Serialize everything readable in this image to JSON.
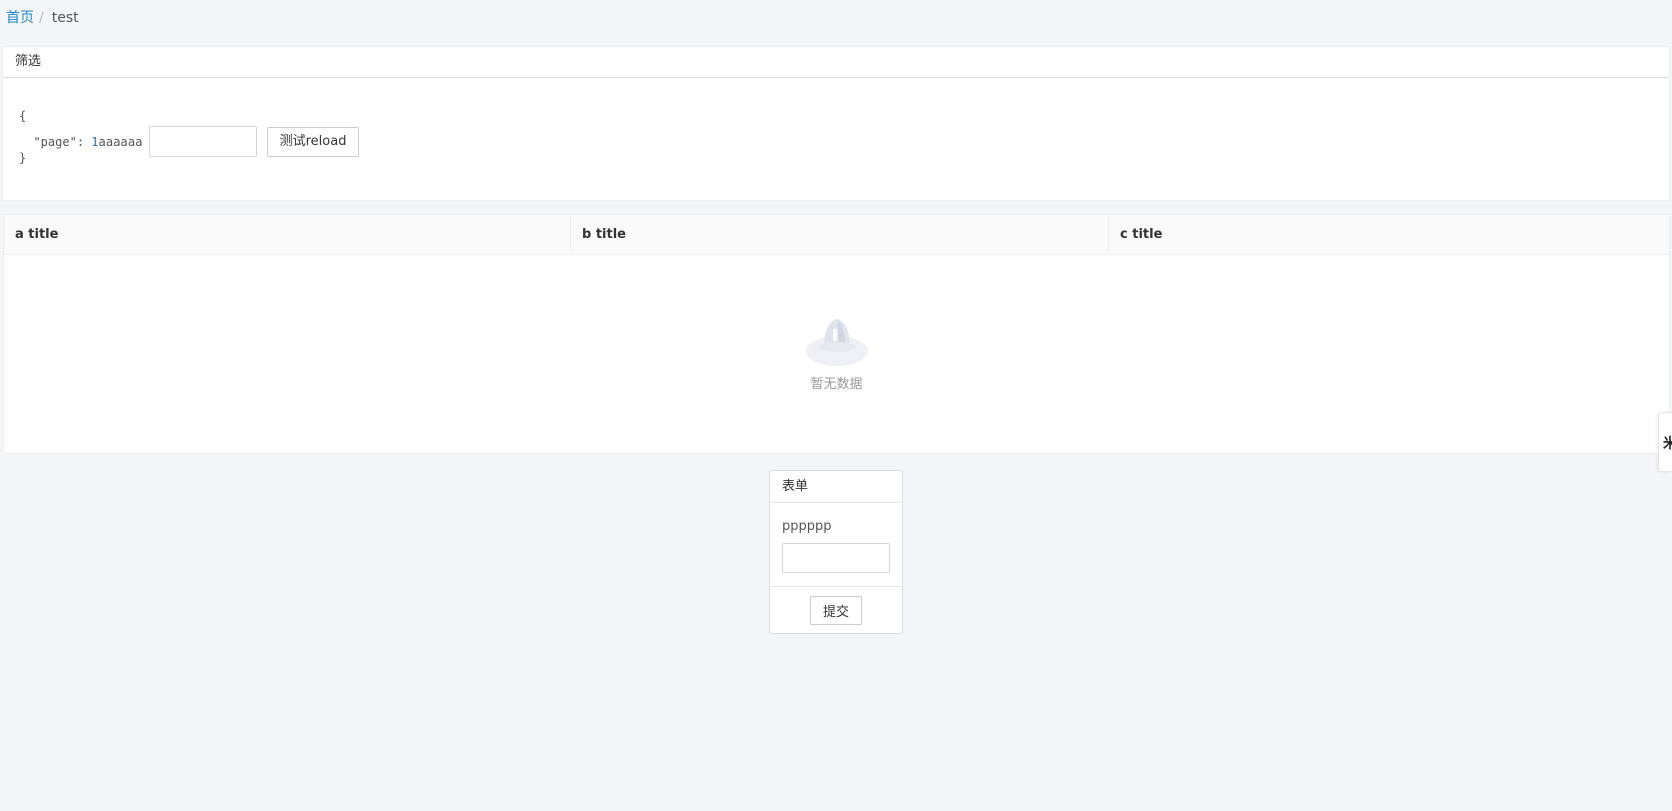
{
  "breadcrumb": {
    "home": "首页",
    "separator": "/",
    "current": "test"
  },
  "filter": {
    "title": "筛选",
    "json_open": "{",
    "json_key": "\"page\"",
    "json_colon": ": ",
    "json_value": "1",
    "json_suffix": "aaaaaa",
    "json_close": "}",
    "input_value": "",
    "reload_label": "测试reload"
  },
  "table": {
    "columns": [
      "a title",
      "b title",
      "c title"
    ],
    "rows": [],
    "empty_text": "暂无数据",
    "empty_icon": "empty-box-icon"
  },
  "side_tab": {
    "glyph": "米"
  },
  "form": {
    "title": "表单",
    "field_label": "pppppp",
    "field_value": "",
    "submit_label": "提交"
  },
  "colors": {
    "link": "#1e88c8",
    "background": "#f4f5f7",
    "panel": "#ffffff",
    "muted_text": "#999999"
  }
}
